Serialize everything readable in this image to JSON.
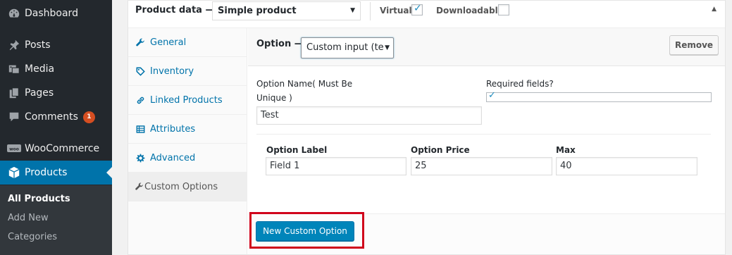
{
  "sidebar": {
    "menu": [
      {
        "label": "Dashboard",
        "icon": "dashboard-icon"
      },
      {
        "label": "Posts",
        "icon": "pin-icon"
      },
      {
        "label": "Media",
        "icon": "media-icon"
      },
      {
        "label": "Pages",
        "icon": "pages-icon"
      },
      {
        "label": "Comments",
        "icon": "comments-icon",
        "badge": "1"
      },
      {
        "label": "WooCommerce",
        "icon": "woo-icon"
      },
      {
        "label": "Products",
        "icon": "products-icon",
        "current": true
      }
    ],
    "submenu": [
      {
        "label": "All Products",
        "current": true
      },
      {
        "label": "Add New"
      },
      {
        "label": "Categories"
      }
    ],
    "colors": {
      "bg": "#23282d",
      "current": "#0073aa",
      "badge": "#d54e21"
    }
  },
  "product_data": {
    "title": "Product data —",
    "type_select": "Simple product",
    "virtual_label": "Virtual:",
    "virtual_checked": true,
    "downloadable_label": "Downloadable:",
    "downloadable_checked": false
  },
  "tabs": [
    {
      "label": "General",
      "icon": "wrench-icon"
    },
    {
      "label": "Inventory",
      "icon": "tag-icon"
    },
    {
      "label": "Linked Products",
      "icon": "link-icon"
    },
    {
      "label": "Attributes",
      "icon": "table-icon"
    },
    {
      "label": "Advanced",
      "icon": "gear-icon"
    },
    {
      "label": "Custom Options",
      "icon": "wrench-icon",
      "active": true
    }
  ],
  "option": {
    "label": "Option —",
    "type_select": "Custom input (te",
    "remove_label": "Remove",
    "name_label_line1": "Option Name( Must Be",
    "name_label_line2": "Unique )",
    "name_value": "Test",
    "required_label": "Required fields?",
    "required_checked": true,
    "table_headers": [
      "Option Label",
      "Option Price",
      "Max"
    ],
    "table_values": [
      "Field 1",
      "25",
      "40"
    ]
  },
  "footer": {
    "new_option_label": "New Custom Option"
  },
  "accent": "#0085ba",
  "highlight_color": "#d0021b"
}
